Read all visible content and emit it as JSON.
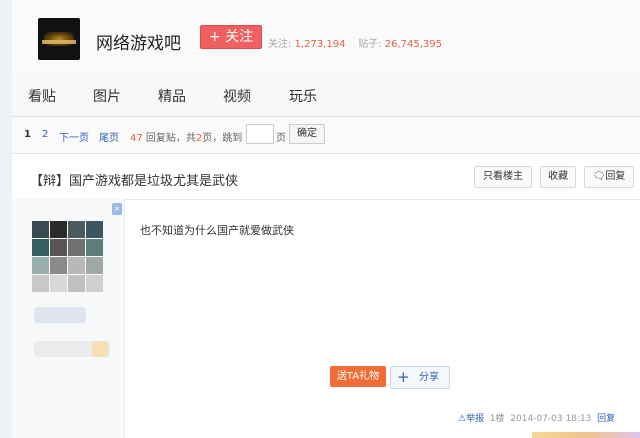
{
  "header": {
    "forum_name": "网络游戏吧",
    "follow_label": "+ 关注",
    "followers_label": "关注:",
    "followers_count": "1,273,194",
    "posts_label": "贴子:",
    "posts_count": "26,745,395"
  },
  "nav": {
    "items": [
      {
        "label": "看贴"
      },
      {
        "label": "图片"
      },
      {
        "label": "精品"
      },
      {
        "label": "视频"
      },
      {
        "label": "玩乐"
      }
    ]
  },
  "pager": {
    "current": "1",
    "page2": "2",
    "next": "下一页",
    "last": "尾页",
    "reply_count": "47",
    "reply_suffix": "回复贴，共",
    "total_pages": "2",
    "pages_suffix": "页，跳到",
    "page_unit": "页",
    "confirm": "确定"
  },
  "thread": {
    "title": "【辩】国产游戏都是垃圾尤其是武侠",
    "only_op": "只看楼主",
    "favorite": "收藏",
    "reply": "回复",
    "reply_icon": "speech-bubble-icon"
  },
  "post": {
    "text": "也不知道为什么国产就爱做武侠",
    "gift_label": "送TA礼物",
    "share_label": "分享",
    "report": "举报",
    "floor": "1楼",
    "timestamp": "2014-07-03 18:13",
    "reply": "回复"
  },
  "colors": {
    "accent_red": "#f06060",
    "link_blue": "#2d64b3",
    "gift_orange": "#f26d36",
    "count_red": "#e0634a"
  }
}
